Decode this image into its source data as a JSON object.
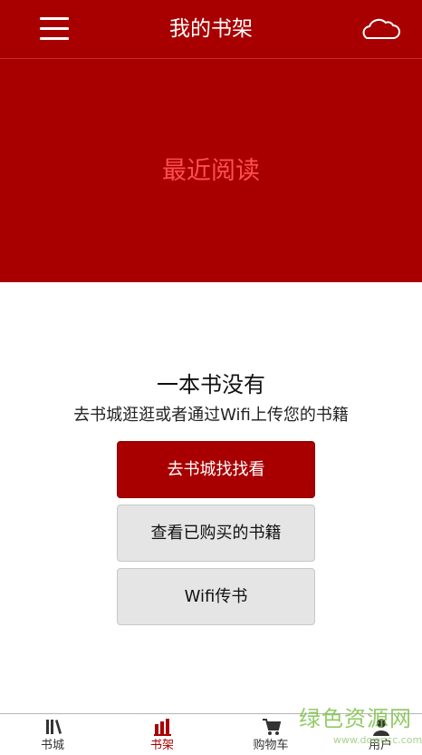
{
  "header": {
    "title": "我的书架",
    "menu_icon": "menu-icon",
    "cloud_icon": "cloud-icon"
  },
  "recent": {
    "label": "最近阅读"
  },
  "empty_state": {
    "title": "一本书没有",
    "subtitle": "去书城逛逛或者通过Wifi上传您的书籍"
  },
  "buttons": {
    "browse_store": "去书城找找看",
    "view_purchased": "查看已购买的书籍",
    "wifi_upload": "Wifi传书"
  },
  "tabbar": {
    "items": [
      {
        "label": "书城",
        "icon": "bookstore-icon",
        "active": false
      },
      {
        "label": "书架",
        "icon": "bookshelf-icon",
        "active": true
      },
      {
        "label": "购物车",
        "icon": "cart-icon",
        "active": false
      },
      {
        "label": "用户",
        "icon": "user-icon",
        "active": false
      }
    ]
  },
  "watermark": {
    "main": "绿色资源网",
    "sub": "www.downcc.com"
  },
  "colors": {
    "brand": "#a80000",
    "recent_text": "#ff4f4f",
    "button_gray": "#e5e5e5"
  }
}
